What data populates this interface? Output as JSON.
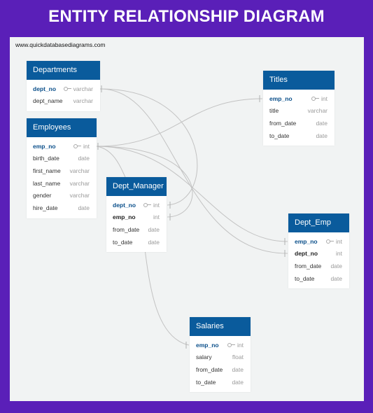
{
  "banner": {
    "title": "ENTITY RELATIONSHIP DIAGRAM"
  },
  "canvas": {
    "watermark": "www.quickdatabasediagrams.com"
  },
  "tables": {
    "departments": {
      "name": "Departments",
      "fields": [
        {
          "name": "dept_no",
          "type": "varchar",
          "key": "pk"
        },
        {
          "name": "dept_name",
          "type": "varchar",
          "key": ""
        }
      ]
    },
    "employees": {
      "name": "Employees",
      "fields": [
        {
          "name": "emp_no",
          "type": "int",
          "key": "pk"
        },
        {
          "name": "birth_date",
          "type": "date",
          "key": ""
        },
        {
          "name": "first_name",
          "type": "varchar",
          "key": ""
        },
        {
          "name": "last_name",
          "type": "varchar",
          "key": ""
        },
        {
          "name": "gender",
          "type": "varchar",
          "key": ""
        },
        {
          "name": "hire_date",
          "type": "date",
          "key": ""
        }
      ]
    },
    "titles": {
      "name": "Titles",
      "fields": [
        {
          "name": "emp_no",
          "type": "int",
          "key": "pk"
        },
        {
          "name": "title",
          "type": "varchar",
          "key": ""
        },
        {
          "name": "from_date",
          "type": "date",
          "key": ""
        },
        {
          "name": "to_date",
          "type": "date",
          "key": ""
        }
      ]
    },
    "dept_manager": {
      "name": "Dept_Manager",
      "fields": [
        {
          "name": "dept_no",
          "type": "int",
          "key": "pk"
        },
        {
          "name": "emp_no",
          "type": "int",
          "key": "fk"
        },
        {
          "name": "from_date",
          "type": "date",
          "key": ""
        },
        {
          "name": "to_date",
          "type": "date",
          "key": ""
        }
      ]
    },
    "dept_emp": {
      "name": "Dept_Emp",
      "fields": [
        {
          "name": "emp_no",
          "type": "int",
          "key": "pk"
        },
        {
          "name": "dept_no",
          "type": "int",
          "key": "fk"
        },
        {
          "name": "from_date",
          "type": "date",
          "key": ""
        },
        {
          "name": "to_date",
          "type": "date",
          "key": ""
        }
      ]
    },
    "salaries": {
      "name": "Salaries",
      "fields": [
        {
          "name": "emp_no",
          "type": "int",
          "key": "pk"
        },
        {
          "name": "salary",
          "type": "float",
          "key": ""
        },
        {
          "name": "from_date",
          "type": "date",
          "key": ""
        },
        {
          "name": "to_date",
          "type": "date",
          "key": ""
        }
      ]
    }
  },
  "colors": {
    "banner_bg": "#5a1fb8",
    "entity_header": "#0a5b9c",
    "primary_key_text": "#0a4f8a",
    "relationship_line": "#c2c2c2"
  }
}
